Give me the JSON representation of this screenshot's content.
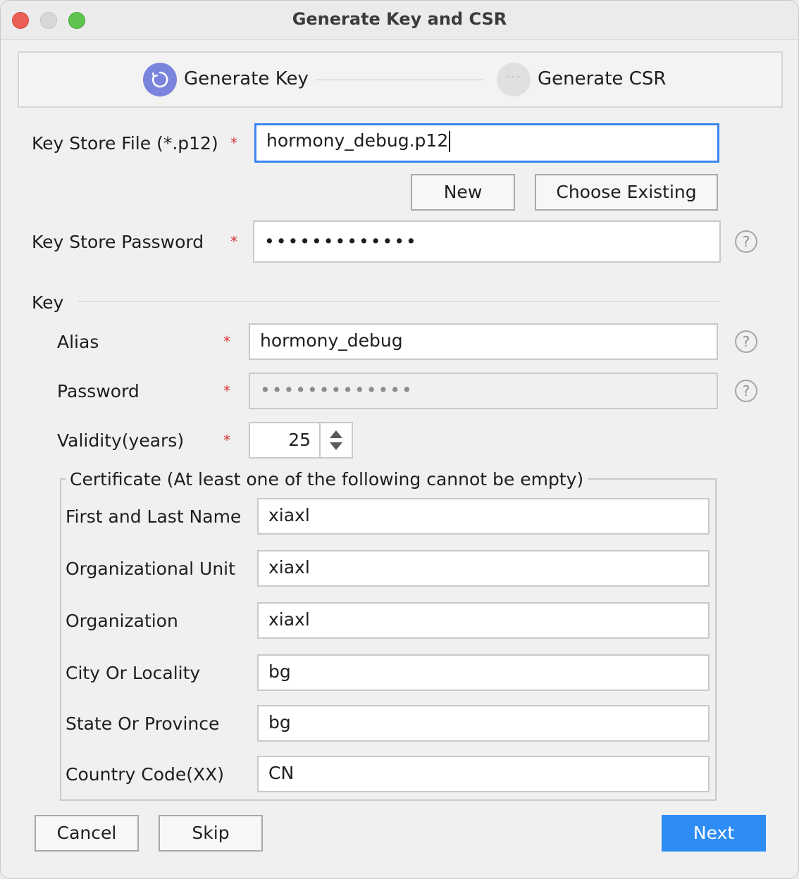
{
  "window": {
    "title": "Generate Key and CSR"
  },
  "steps": [
    {
      "label": "Generate Key"
    },
    {
      "label": "Generate CSR"
    }
  ],
  "keystore": {
    "file_label": "Key Store File (*.p12)",
    "file_value": "hormony_debug.p12",
    "new_label": "New",
    "choose_label": "Choose Existing",
    "password_label": "Key Store Password",
    "password_value": "•••••••••••••"
  },
  "required_mark": "*",
  "help_glyph": "?",
  "key": {
    "section_label": "Key",
    "alias_label": "Alias",
    "alias_value": "hormony_debug",
    "password_label": "Password",
    "password_value": "•••••••••••••",
    "validity_label": "Validity(years)",
    "validity_value": "25"
  },
  "certificate": {
    "legend": "Certificate (At least one of the following cannot be empty)",
    "fields": [
      {
        "label": "First and Last Name",
        "value": "xiaxl"
      },
      {
        "label": "Organizational Unit",
        "value": "xiaxl"
      },
      {
        "label": "Organization",
        "value": "xiaxl"
      },
      {
        "label": "City Or Locality",
        "value": "bg"
      },
      {
        "label": "State Or Province",
        "value": "bg"
      },
      {
        "label": "Country Code(XX)",
        "value": "CN"
      }
    ]
  },
  "footer": {
    "cancel_label": "Cancel",
    "skip_label": "Skip",
    "next_label": "Next"
  },
  "colors": {
    "accent": "#2e8cf5",
    "focus": "#3c83f0",
    "step_active": "#7b84dc",
    "required": "#d9383a"
  }
}
